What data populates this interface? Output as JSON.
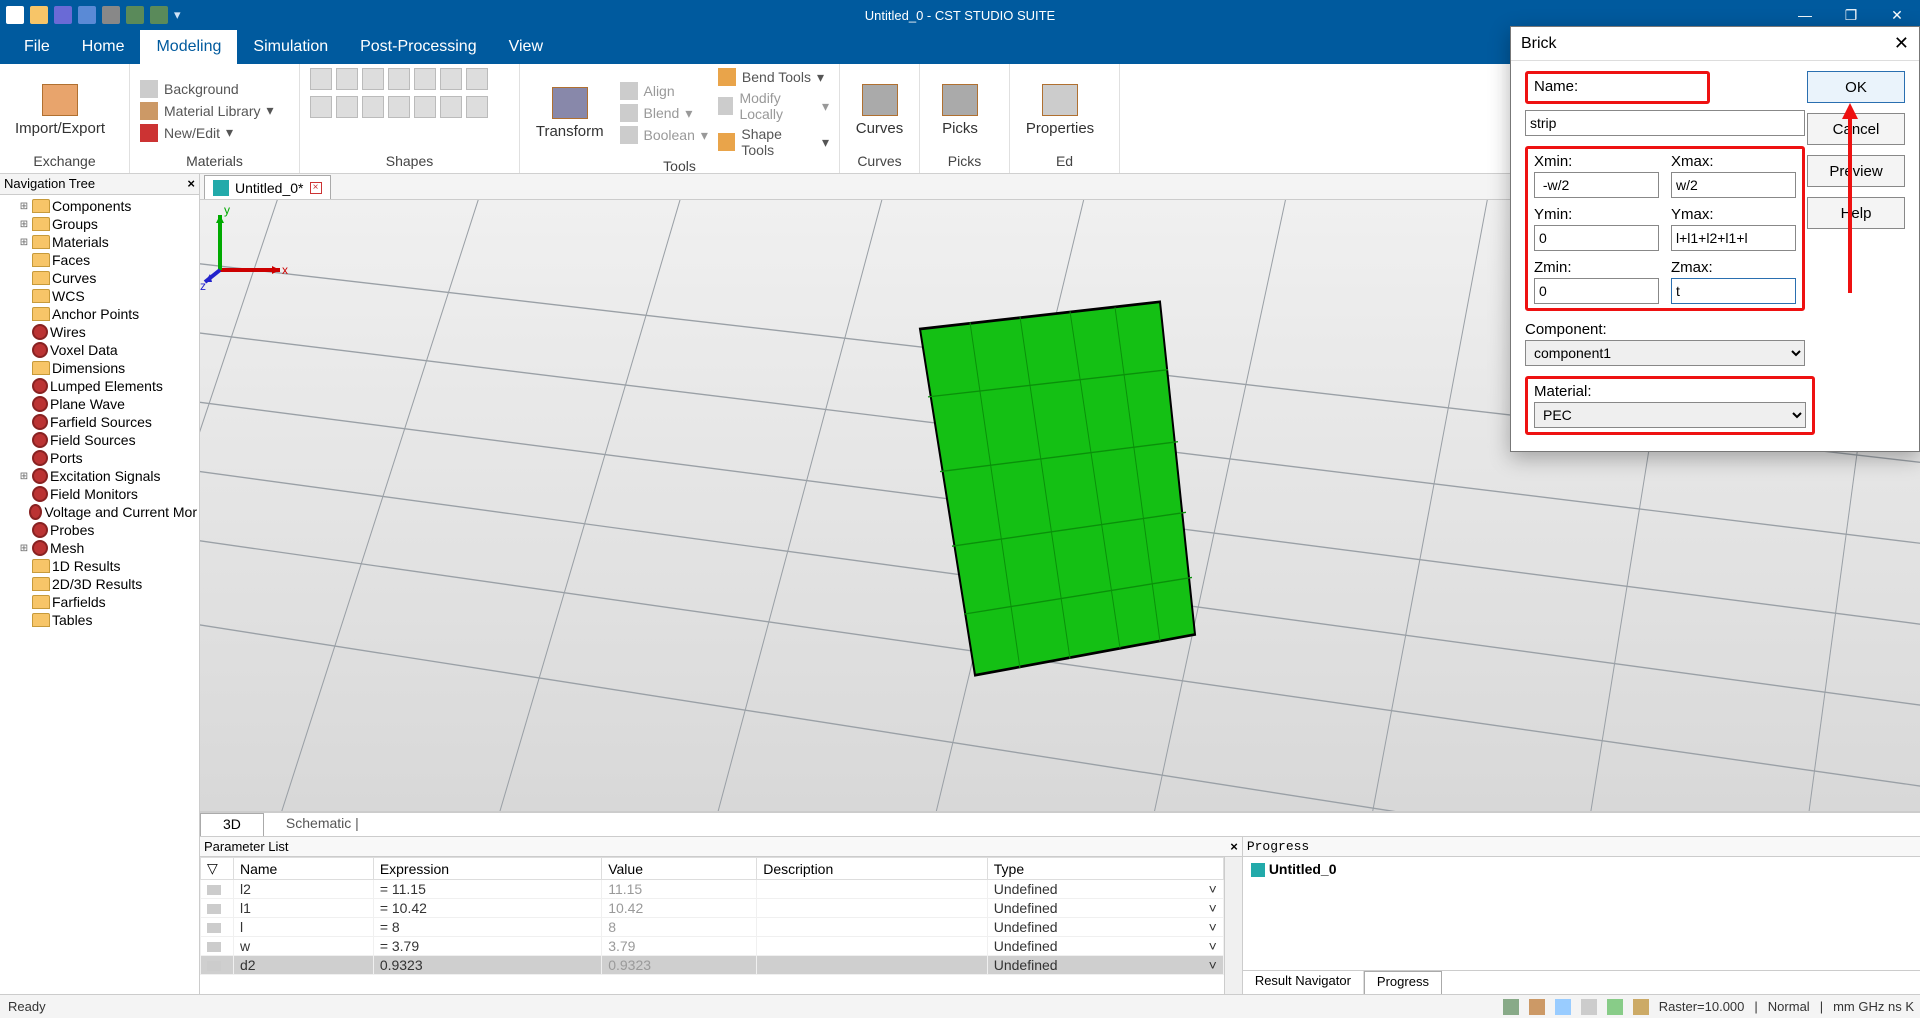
{
  "titlebar": {
    "title": "Untitled_0 - CST STUDIO SUITE",
    "min": "—",
    "max": "❐",
    "close": "✕"
  },
  "menu": {
    "items": [
      "File",
      "Home",
      "Modeling",
      "Simulation",
      "Post-Processing",
      "View"
    ],
    "active": "Modeling"
  },
  "ribbon": {
    "exchange": {
      "btn": "Import/Export",
      "label": "Exchange"
    },
    "materials": {
      "items": [
        "Background",
        "Material Library",
        "New/Edit"
      ],
      "label": "Materials"
    },
    "shapes": {
      "label": "Shapes",
      "transform": "Transform"
    },
    "tools": {
      "label": "Tools",
      "left": [
        "Align",
        "Blend",
        "Boolean"
      ],
      "right": [
        "Bend Tools",
        "Modify Locally",
        "Shape Tools"
      ]
    },
    "curves": {
      "btn": "Curves",
      "label": "Curves"
    },
    "picks": {
      "btn": "Picks",
      "label": "Picks"
    },
    "edit": {
      "btn": "Properties",
      "label": "Ed"
    }
  },
  "nav": {
    "title": "Navigation Tree",
    "nodes": [
      {
        "t": "Components",
        "k": "f",
        "exp": "⊞"
      },
      {
        "t": "Groups",
        "k": "f",
        "exp": "⊞"
      },
      {
        "t": "Materials",
        "k": "f",
        "exp": "⊞"
      },
      {
        "t": "Faces",
        "k": "f"
      },
      {
        "t": "Curves",
        "k": "f"
      },
      {
        "t": "WCS",
        "k": "f"
      },
      {
        "t": "Anchor Points",
        "k": "f"
      },
      {
        "t": "Wires",
        "k": "g"
      },
      {
        "t": "Voxel Data",
        "k": "g"
      },
      {
        "t": "Dimensions",
        "k": "f"
      },
      {
        "t": "Lumped Elements",
        "k": "g"
      },
      {
        "t": "Plane Wave",
        "k": "g"
      },
      {
        "t": "Farfield Sources",
        "k": "g"
      },
      {
        "t": "Field Sources",
        "k": "g"
      },
      {
        "t": "Ports",
        "k": "g"
      },
      {
        "t": "Excitation Signals",
        "k": "g",
        "exp": "⊞"
      },
      {
        "t": "Field Monitors",
        "k": "g"
      },
      {
        "t": "Voltage and Current Mor",
        "k": "g"
      },
      {
        "t": "Probes",
        "k": "g"
      },
      {
        "t": "Mesh",
        "k": "g",
        "exp": "⊞"
      },
      {
        "t": "1D Results",
        "k": "f"
      },
      {
        "t": "2D/3D Results",
        "k": "f"
      },
      {
        "t": "Farfields",
        "k": "f"
      },
      {
        "t": "Tables",
        "k": "f"
      }
    ]
  },
  "doctab": {
    "label": "Untitled_0*"
  },
  "viewtabs": {
    "a": "3D",
    "b": "Schematic  |"
  },
  "paramlist": {
    "title": "Parameter List",
    "cols": [
      "Name",
      "Expression",
      "Value",
      "Description",
      "Type"
    ],
    "rows": [
      {
        "n": "l2",
        "e": "= 11.15",
        "v": "11.15",
        "d": "",
        "t": "Undefined"
      },
      {
        "n": "l1",
        "e": "= 10.42",
        "v": "10.42",
        "d": "",
        "t": "Undefined"
      },
      {
        "n": "l",
        "e": "= 8",
        "v": "8",
        "d": "",
        "t": "Undefined"
      },
      {
        "n": "w",
        "e": "= 3.79",
        "v": "3.79",
        "d": "",
        "t": "Undefined"
      },
      {
        "n": "d2",
        "e": "  0.9323",
        "v": "0.9323",
        "d": "",
        "t": "Undefined",
        "sel": true
      }
    ]
  },
  "progress": {
    "title": "Progress",
    "item": "Untitled_0",
    "tabs": [
      "Result Navigator",
      "Progress"
    ],
    "active": "Progress"
  },
  "status": {
    "ready": "Ready",
    "raster": "Raster=10.000",
    "mode": "Normal",
    "units": "mm  GHz  ns  K"
  },
  "brick": {
    "title": "Brick",
    "name_label": "Name:",
    "name_value": "strip",
    "xmin_label": "Xmin:",
    "xmin": " -w/2",
    "xmax_label": "Xmax:",
    "xmax": "w/2",
    "ymin_label": "Ymin:",
    "ymin": "0",
    "ymax_label": "Ymax:",
    "ymax": "l+l1+l2+l1+l",
    "zmin_label": "Zmin:",
    "zmin": "0",
    "zmax_label": "Zmax:",
    "zmax": "t",
    "component_label": "Component:",
    "component": "component1",
    "material_label": "Material:",
    "material": "PEC",
    "ok": "OK",
    "cancel": "Cancel",
    "preview": "Preview",
    "help": "Help"
  },
  "axes": {
    "x": "x",
    "y": "y",
    "z": "z"
  }
}
